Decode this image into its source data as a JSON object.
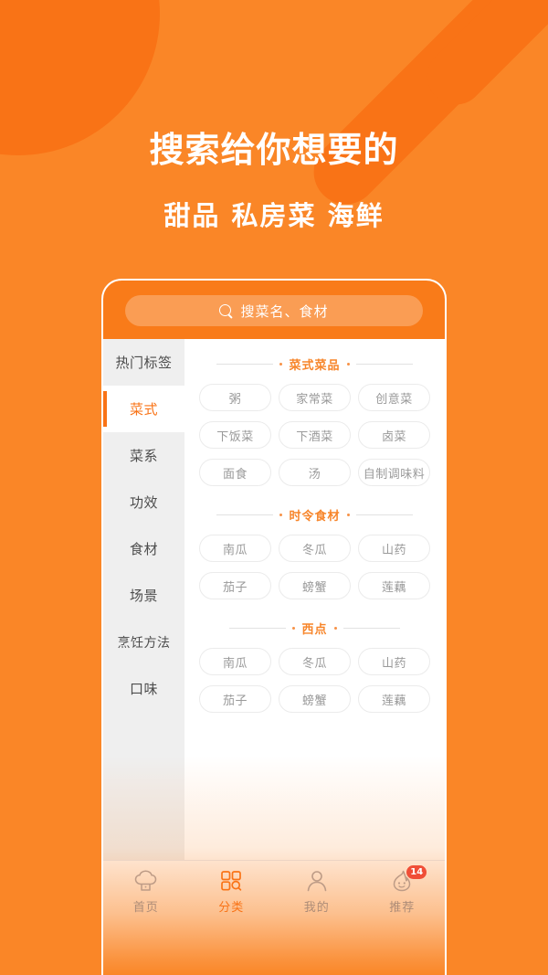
{
  "hero": {
    "title": "搜索给你想要的",
    "subtitle": "甜品 私房菜 海鲜"
  },
  "colors": {
    "background": "#FA8627",
    "accent": "#F97316",
    "header": "#F97B19",
    "sidebar": "#EFEFEF",
    "tag_border": "#EBEBEB",
    "tag_text": "#9A9A9A",
    "badge": "#F04E37"
  },
  "search": {
    "placeholder": "搜菜名、食材",
    "icon": "search-icon"
  },
  "sidebar": {
    "items": [
      {
        "label": "热门标签",
        "active": false
      },
      {
        "label": "菜式",
        "active": true
      },
      {
        "label": "菜系",
        "active": false
      },
      {
        "label": "功效",
        "active": false
      },
      {
        "label": "食材",
        "active": false
      },
      {
        "label": "场景",
        "active": false
      },
      {
        "label": "烹饪方法",
        "active": false
      },
      {
        "label": "口味",
        "active": false
      }
    ]
  },
  "content": {
    "sections": [
      {
        "title": "菜式菜品",
        "tags": [
          "粥",
          "家常菜",
          "创意菜",
          "下饭菜",
          "下酒菜",
          "卤菜",
          "面食",
          "汤",
          "自制调味料"
        ]
      },
      {
        "title": "时令食材",
        "tags": [
          "南瓜",
          "冬瓜",
          "山药",
          "茄子",
          "螃蟹",
          "莲藕"
        ]
      },
      {
        "title": "西点",
        "tags": [
          "南瓜",
          "冬瓜",
          "山药",
          "茄子",
          "螃蟹",
          "莲藕"
        ]
      }
    ]
  },
  "tabbar": {
    "items": [
      {
        "label": "首页",
        "icon": "chef-hat-icon",
        "active": false,
        "badge": null
      },
      {
        "label": "分类",
        "icon": "grid-search-icon",
        "active": true,
        "badge": null
      },
      {
        "label": "我的",
        "icon": "person-icon",
        "active": false,
        "badge": null
      },
      {
        "label": "推荐",
        "icon": "flame-smile-icon",
        "active": false,
        "badge": "14"
      }
    ]
  }
}
